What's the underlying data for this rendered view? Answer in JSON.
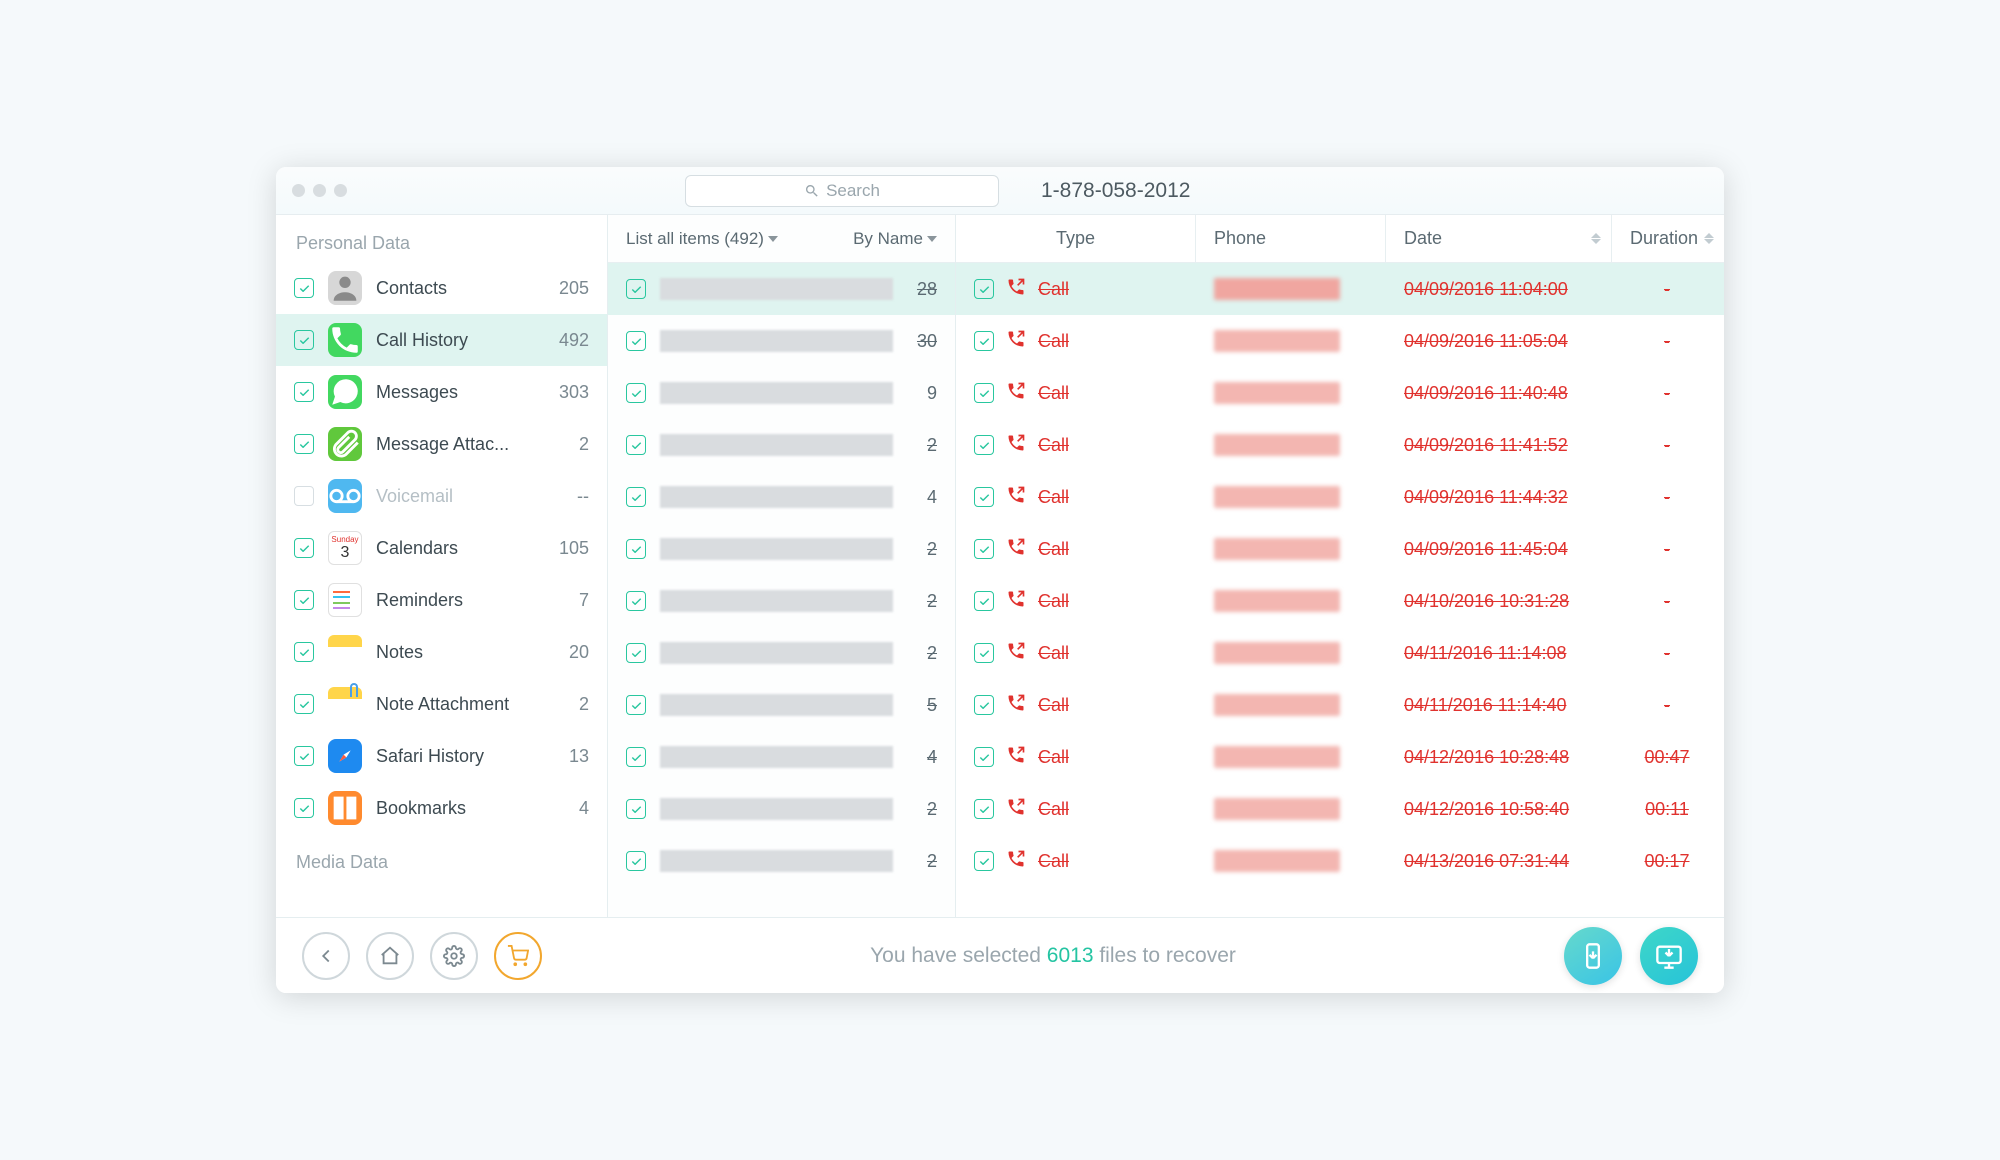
{
  "search": {
    "placeholder": "Search"
  },
  "header": {
    "phone_number": "1-878-058-2012"
  },
  "sidebar": {
    "groups": [
      {
        "label": "Personal Data"
      },
      {
        "label": "Media Data"
      }
    ],
    "items": [
      {
        "label": "Contacts",
        "count": "205",
        "icon": "contacts",
        "bg": "#d7d7d7",
        "checked": true
      },
      {
        "label": "Call History",
        "count": "492",
        "icon": "phone",
        "bg": "#42d860",
        "checked": true,
        "selected": true
      },
      {
        "label": "Messages",
        "count": "303",
        "icon": "message",
        "bg": "#42d860",
        "checked": true
      },
      {
        "label": "Message Attac...",
        "count": "2",
        "icon": "attach",
        "bg": "#60c83c",
        "checked": true
      },
      {
        "label": "Voicemail",
        "count": "--",
        "icon": "voicemail",
        "bg": "#4fb8f0",
        "checked": false,
        "disabled": true
      },
      {
        "label": "Calendars",
        "count": "105",
        "icon": "calendar",
        "bg": "#ffffff",
        "checked": true
      },
      {
        "label": "Reminders",
        "count": "7",
        "icon": "reminders",
        "bg": "#ffffff",
        "checked": true
      },
      {
        "label": "Notes",
        "count": "20",
        "icon": "notes",
        "bg": "#ffd54a",
        "checked": true
      },
      {
        "label": "Note Attachment",
        "count": "2",
        "icon": "noteattach",
        "bg": "#ffd54a",
        "checked": true
      },
      {
        "label": "Safari History",
        "count": "13",
        "icon": "safari",
        "bg": "#1e8af0",
        "checked": true
      },
      {
        "label": "Bookmarks",
        "count": "4",
        "icon": "bookmarks",
        "bg": "#ff8a2e",
        "checked": true
      }
    ]
  },
  "middle": {
    "list_label": "List all items (492)",
    "sort_label": "By Name",
    "rows": [
      {
        "count": "28",
        "strike": true,
        "selected": true
      },
      {
        "count": "30",
        "strike": true
      },
      {
        "count": "9",
        "strike": false
      },
      {
        "count": "2",
        "strike": true
      },
      {
        "count": "4",
        "strike": false
      },
      {
        "count": "2",
        "strike": true
      },
      {
        "count": "2",
        "strike": true
      },
      {
        "count": "2",
        "strike": true
      },
      {
        "count": "5",
        "strike": true
      },
      {
        "count": "4",
        "strike": true
      },
      {
        "count": "2",
        "strike": true
      },
      {
        "count": "2",
        "strike": true
      }
    ]
  },
  "detail": {
    "columns": {
      "type": "Type",
      "phone": "Phone",
      "date": "Date",
      "duration": "Duration"
    },
    "rows": [
      {
        "type": "Call",
        "date": "04/09/2016 11:04:00",
        "duration": "-",
        "selected": true
      },
      {
        "type": "Call",
        "date": "04/09/2016 11:05:04",
        "duration": "-"
      },
      {
        "type": "Call",
        "date": "04/09/2016 11:40:48",
        "duration": "-"
      },
      {
        "type": "Call",
        "date": "04/09/2016 11:41:52",
        "duration": "-"
      },
      {
        "type": "Call",
        "date": "04/09/2016 11:44:32",
        "duration": "-"
      },
      {
        "type": "Call",
        "date": "04/09/2016 11:45:04",
        "duration": "-"
      },
      {
        "type": "Call",
        "date": "04/10/2016 10:31:28",
        "duration": "-"
      },
      {
        "type": "Call",
        "date": "04/11/2016 11:14:08",
        "duration": "-"
      },
      {
        "type": "Call",
        "date": "04/11/2016 11:14:40",
        "duration": "-"
      },
      {
        "type": "Call",
        "date": "04/12/2016 10:28:48",
        "duration": "00:47"
      },
      {
        "type": "Call",
        "date": "04/12/2016 10:58:40",
        "duration": "00:11"
      },
      {
        "type": "Call",
        "date": "04/13/2016 07:31:44",
        "duration": "00:17"
      }
    ]
  },
  "footer": {
    "prefix": "You have selected ",
    "count": "6013",
    "suffix": " files to recover"
  }
}
